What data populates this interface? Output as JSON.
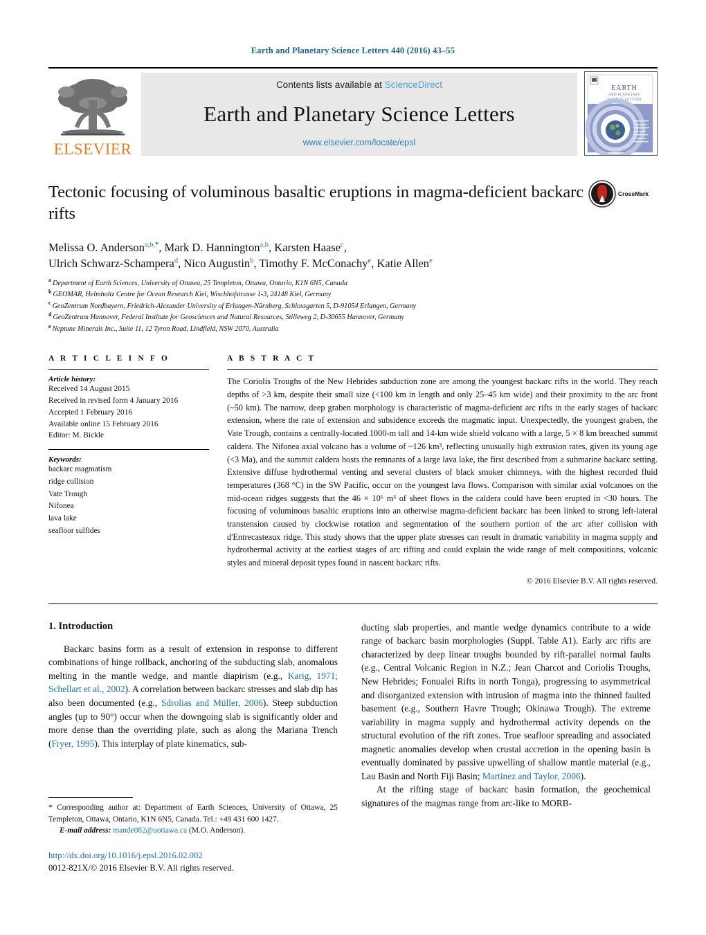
{
  "running_head": "Earth and Planetary Science Letters 440 (2016) 43–55",
  "masthead": {
    "contents_prefix": "Contents lists available at ",
    "sciencedirect": "ScienceDirect",
    "journal_title": "Earth and Planetary Science Letters",
    "journal_url": "www.elsevier.com/locate/epsl",
    "publisher": "ELSEVIER",
    "cover_title_line1": "EARTH",
    "cover_title_line2": "AND PLANETARY",
    "cover_title_line3": "SCIENCE LETTERS"
  },
  "article": {
    "title": "Tectonic focusing of voluminous basaltic eruptions in magma-deficient backarc rifts",
    "crossmark_label": "CrossMark"
  },
  "authors": {
    "line1": [
      {
        "name": "Melissa O. Anderson",
        "marks": "a,b,*"
      },
      {
        "name": "Mark D. Hannington",
        "marks": "a,b"
      },
      {
        "name": "Karsten Haase",
        "marks": "c"
      }
    ],
    "line2": [
      {
        "name": "Ulrich Schwarz-Schampera",
        "marks": "d"
      },
      {
        "name": "Nico Augustin",
        "marks": "b"
      },
      {
        "name": "Timothy F. McConachy",
        "marks": "e"
      },
      {
        "name": "Katie Allen",
        "marks": "e"
      }
    ]
  },
  "affiliations": [
    {
      "mark": "a",
      "text": "Department of Earth Sciences, University of Ottawa, 25 Templeton, Ottawa, Ontario, K1N 6N5, Canada"
    },
    {
      "mark": "b",
      "text": "GEOMAR, Helmholtz Centre for Ocean Research Kiel, Wischhofstrasse 1-3, 24148 Kiel, Germany"
    },
    {
      "mark": "c",
      "text": "GeoZentrum Nordbayern, Friedrich-Alexander University of Erlangen-Nürnberg, Schlossgarten 5, D-91054 Erlangen, Germany"
    },
    {
      "mark": "d",
      "text": "GeoZentrum Hannover, Federal Institute for Geosciences and Natural Resources, Stilleweg 2, D-30655 Hannover, Germany"
    },
    {
      "mark": "e",
      "text": "Neptune Minerals Inc., Suite 11, 12 Tyron Road, Lindfield, NSW 2070, Australia"
    }
  ],
  "article_info": {
    "heading": "A R T I C L E   I N F O",
    "history_label": "Article history:",
    "history": [
      "Received 14 August 2015",
      "Received in revised form 4 January 2016",
      "Accepted 1 February 2016",
      "Available online 15 February 2016",
      "Editor: M. Bickle"
    ],
    "keywords_label": "Keywords:",
    "keywords": [
      "backarc magmatism",
      "ridge collision",
      "Vate Trough",
      "Nifonea",
      "lava lake",
      "seafloor sulfides"
    ]
  },
  "abstract": {
    "heading": "A B S T R A C T",
    "text": "The Coriolis Troughs of the New Hebrides subduction zone are among the youngest backarc rifts in the world. They reach depths of >3 km, despite their small size (<100 km in length and only 25–45 km wide) and their proximity to the arc front (~50 km). The narrow, deep graben morphology is characteristic of magma-deficient arc rifts in the early stages of backarc extension, where the rate of extension and subsidence exceeds the magmatic input. Unexpectedly, the youngest graben, the Vate Trough, contains a centrally-located 1000-m tall and 14-km wide shield volcano with a large, 5 × 8 km breached summit caldera. The Nifonea axial volcano has a volume of ~126 km³, reflecting unusually high extrusion rates, given its young age (<3 Ma), and the summit caldera hosts the remnants of a large lava lake, the first described from a submarine backarc setting. Extensive diffuse hydrothermal venting and several clusters of black smoker chimneys, with the highest recorded fluid temperatures (368 °C) in the SW Pacific, occur on the youngest lava flows. Comparison with similar axial volcanoes on the mid-ocean ridges suggests that the 46 × 10⁶ m³ of sheet flows in the caldera could have been erupted in <30 hours. The focusing of voluminous basaltic eruptions into an otherwise magma-deficient backarc has been linked to strong left-lateral transtension caused by clockwise rotation and segmentation of the southern portion of the arc after collision with d'Entrecasteaux ridge. This study shows that the upper plate stresses can result in dramatic variability in magma supply and hydrothermal activity at the earliest stages of arc rifting and could explain the wide range of melt compositions, volcanic styles and mineral deposit types found in nascent backarc rifts.",
    "copyright": "© 2016 Elsevier B.V. All rights reserved."
  },
  "introduction": {
    "section_title": "1. Introduction",
    "left_paragraph_parts": [
      {
        "t": "Backarc basins form as a result of extension in response to different combinations of hinge rollback, anchoring of the subducting slab, anomalous melting in the mantle wedge, and mantle diapirism (e.g., ",
        "link": false
      },
      {
        "t": "Karig, 1971; Schellart et al., 2002",
        "link": true
      },
      {
        "t": "). A correlation between backarc stresses and slab dip has also been documented (e.g., ",
        "link": false
      },
      {
        "t": "Sdrolias and Müller, 2006",
        "link": true
      },
      {
        "t": "). Steep subduction angles (up to 90°) occur when the downgoing slab is significantly older and more dense than the overriding plate, such as along the Mariana Trench (",
        "link": false
      },
      {
        "t": "Fryer, 1995",
        "link": true
      },
      {
        "t": "). This interplay of plate kinematics, sub-",
        "link": false
      }
    ],
    "right_paragraph_parts": [
      {
        "t": "ducting slab properties, and mantle wedge dynamics contribute to a wide range of backarc basin morphologies (Suppl. Table A1). Early arc rifts are characterized by deep linear troughs bounded by rift-parallel normal faults (e.g., Central Volcanic Region in N.Z.; Jean Charcot and Coriolis Troughs, New Hebrides; Fonualei Rifts in north Tonga), progressing to asymmetrical and disorganized extension with intrusion of magma into the thinned faulted basement (e.g., Southern Havre Trough; Okinawa Trough). The extreme variability in magma supply and hydrothermal activity depends on the structural evolution of the rift zones. True seafloor spreading and associated magnetic anomalies develop when crustal accretion in the opening basin is eventually dominated by passive upwelling of shallow mantle material (e.g., Lau Basin and North Fiji Basin; ",
        "link": false
      },
      {
        "t": "Martinez and Taylor, 2006",
        "link": true
      },
      {
        "t": ").",
        "link": false
      }
    ],
    "right_paragraph2": "At the rifting stage of backarc basin formation, the geochemical signatures of the magmas range from arc-like to MORB-"
  },
  "footnote": {
    "star": "*",
    "corresponding": "Corresponding author at: Department of Earth Sciences, University of Ottawa, 25 Templeton, Ottawa, Ontario, K1N 6N5, Canada. Tel.: +49 431 600 1427.",
    "email_label": "E-mail address:",
    "email": "mande082@uottawa.ca",
    "email_owner": "(M.O. Anderson).",
    "doi": "http://dx.doi.org/10.1016/j.epsl.2016.02.002",
    "issn": "0012-821X/© 2016 Elsevier B.V. All rights reserved."
  },
  "colors": {
    "link": "#1a74a8",
    "sciencedirect": "#4a9fd4",
    "elsevier_orange": "#ef7d1a",
    "running_head": "#1a6496"
  }
}
